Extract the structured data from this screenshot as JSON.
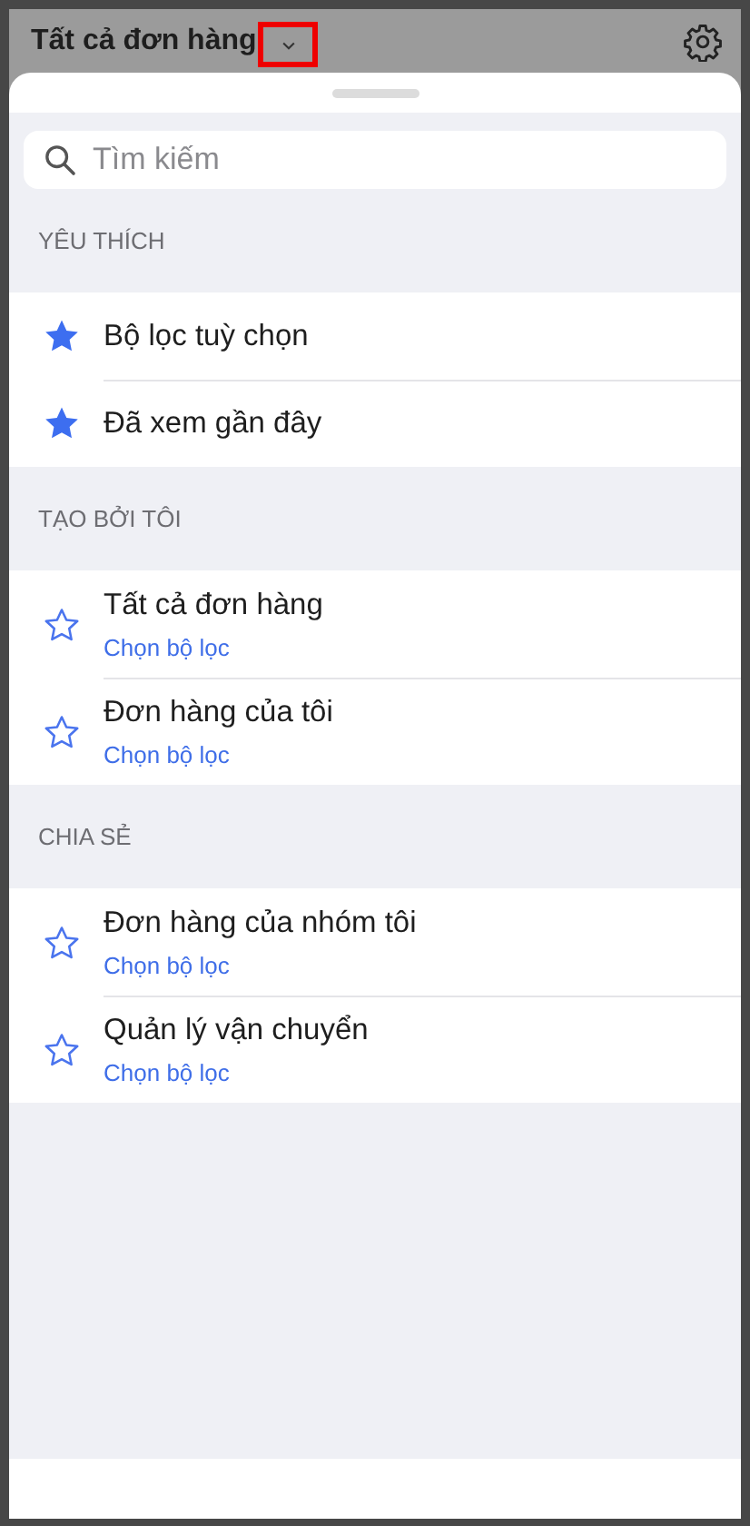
{
  "header": {
    "title": "Tất cả đơn hàng",
    "dropdown_highlighted": true
  },
  "search": {
    "placeholder": "Tìm kiếm"
  },
  "sections": [
    {
      "title": "YÊU THÍCH",
      "items": [
        {
          "title": "Bộ lọc tuỳ chọn",
          "favorite": true
        },
        {
          "title": "Đã xem gần đây",
          "favorite": true
        }
      ]
    },
    {
      "title": "TẠO BỞI TÔI",
      "items": [
        {
          "title": "Tất cả đơn hàng",
          "subtitle": "Chọn bộ lọc",
          "favorite": false
        },
        {
          "title": "Đơn hàng của tôi",
          "subtitle": "Chọn bộ lọc",
          "favorite": false
        }
      ]
    },
    {
      "title": "CHIA SẺ",
      "items": [
        {
          "title": "Đơn hàng của nhóm tôi",
          "subtitle": "Chọn bộ lọc",
          "favorite": false
        },
        {
          "title": "Quản lý vận chuyển",
          "subtitle": "Chọn bộ lọc",
          "favorite": false
        }
      ]
    }
  ]
}
